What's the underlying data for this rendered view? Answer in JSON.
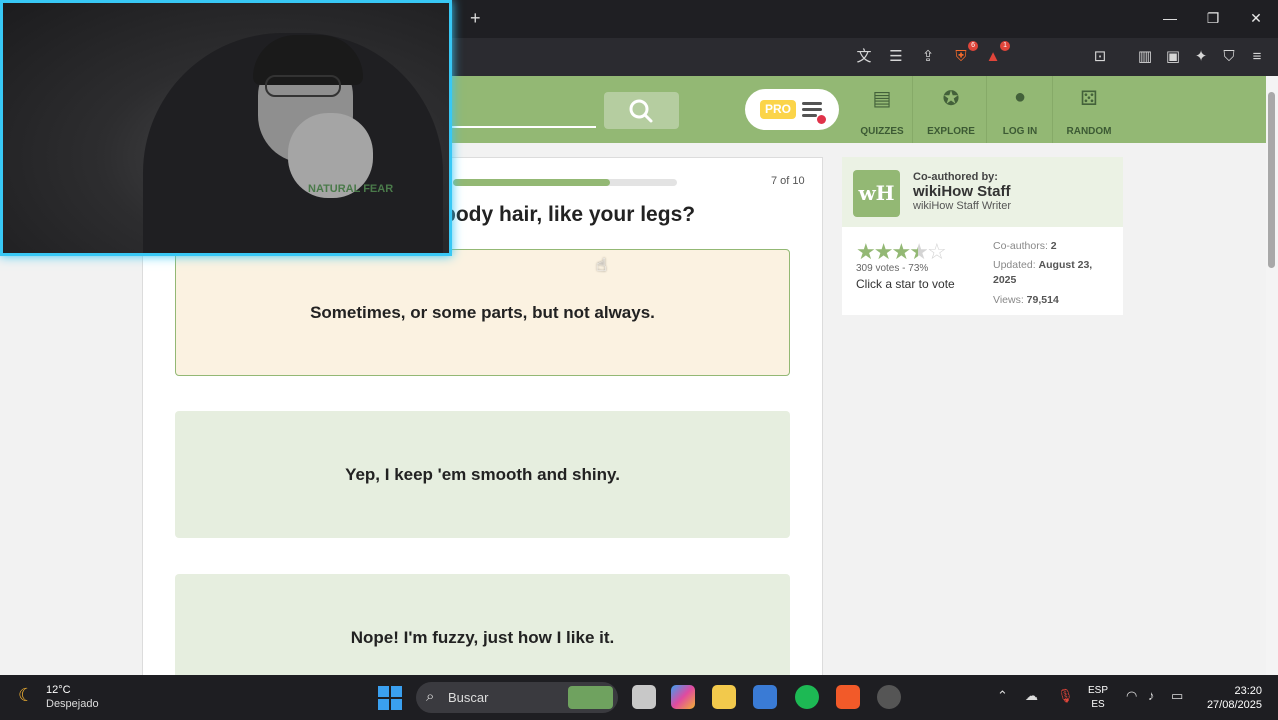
{
  "browser": {
    "new_tab": "+",
    "window_controls": [
      "—",
      "❐",
      "✕"
    ],
    "toolbar_icons": [
      "translate-icon",
      "reader-icon",
      "share-icon",
      "brave-shields-icon",
      "brave-rewards-icon",
      "tab-search-icon",
      "sidebar-icon",
      "wallet-icon",
      "leo-ai-icon",
      "vpn-icon",
      "menu-icon"
    ],
    "shields_badge": "6",
    "rewards_badge": "1"
  },
  "header": {
    "pro_label": "PRO",
    "nav": [
      {
        "label": "QUIZZES",
        "icon": "quiz-icon"
      },
      {
        "label": "EXPLORE",
        "icon": "compass-icon"
      },
      {
        "label": "LOG IN",
        "icon": "user-icon"
      },
      {
        "label": "RANDOM",
        "icon": "dice-icon"
      }
    ]
  },
  "quiz": {
    "progress_text": "7 of 10",
    "progress_fraction": 0.7,
    "question": "body hair, like your legs?",
    "answers": [
      {
        "text": "Sometimes, or some parts, but not always.",
        "selected": true
      },
      {
        "text": "Yep, I keep 'em smooth and shiny.",
        "selected": false
      },
      {
        "text": "Nope! I'm fuzzy, just how I like it.",
        "selected": false
      }
    ]
  },
  "sidebar": {
    "coauthored_label": "Co-authored by:",
    "author_name": "wikiHow Staff",
    "author_role": "wikiHow Staff Writer",
    "logo_text": "wH",
    "rating": 3.5,
    "votes_text": "309 votes - 73%",
    "vote_cta": "Click a star to vote",
    "coauthors_label": "Co-authors:",
    "coauthors_value": "2",
    "updated_label": "Updated:",
    "updated_value": "August 23, 2025",
    "views_label": "Views:",
    "views_value": "79,514"
  },
  "webcam": {
    "shirt_text": "NATURAL FEAR"
  },
  "taskbar": {
    "weather_temp": "12°C",
    "weather_desc": "Despejado",
    "search_placeholder": "Buscar",
    "lang_top": "ESP",
    "lang_bottom": "ES",
    "time": "23:20",
    "date": "27/08/2025"
  }
}
